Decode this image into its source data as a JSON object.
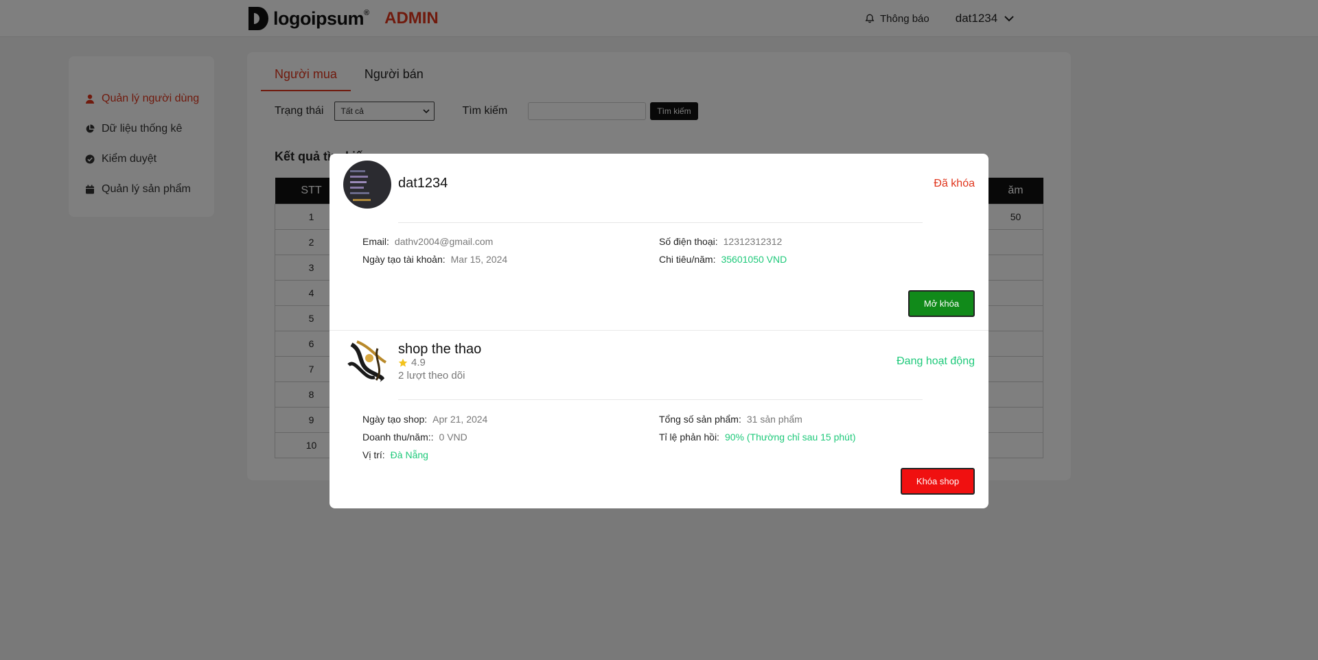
{
  "header": {
    "logo_text": "logoipsum",
    "logo_reg": "®",
    "admin_label": "ADMIN",
    "notification_label": "Thông báo",
    "username": "dat1234"
  },
  "sidebar": {
    "items": [
      {
        "label": "Quản lý người dùng",
        "icon": "user-icon",
        "active": true
      },
      {
        "label": "Dữ liệu thống kê",
        "icon": "pie-chart-icon",
        "active": false
      },
      {
        "label": "Kiểm duyệt",
        "icon": "check-circle-icon",
        "active": false
      },
      {
        "label": "Quản lý sản phẩm",
        "icon": "calendar-icon",
        "active": false
      }
    ]
  },
  "main": {
    "tabs": [
      {
        "label": "Người mua",
        "active": true
      },
      {
        "label": "Người bán",
        "active": false
      }
    ],
    "filters": {
      "status_label": "Trạng thái",
      "status_value": "Tất cả",
      "search_label": "Tìm kiếm",
      "search_value": "",
      "search_button": "Tìm kiếm"
    },
    "result_title": "Kết quả tìm kiếm",
    "table": {
      "headers": [
        "STT",
        "ăm"
      ],
      "rows": [
        {
          "stt": "1",
          "last": "50"
        },
        {
          "stt": "2",
          "last": ""
        },
        {
          "stt": "3",
          "last": ""
        },
        {
          "stt": "4",
          "last": ""
        },
        {
          "stt": "5",
          "last": ""
        },
        {
          "stt": "6",
          "last": ""
        },
        {
          "stt": "7",
          "last": ""
        },
        {
          "stt": "8",
          "last": ""
        },
        {
          "stt": "9",
          "last": ""
        },
        {
          "stt": "10",
          "last": ""
        }
      ]
    }
  },
  "modal": {
    "buyer": {
      "name": "dat1234",
      "status": "Đã khóa",
      "email_label": "Email:",
      "email": "dathv2004@gmail.com",
      "phone_label": "Số điện thoại:",
      "phone": "12312312312",
      "created_label": "Ngày tạo tài khoản:",
      "created": "Mar 15, 2024",
      "spending_label": "Chi tiêu/năm:",
      "spending": "35601050 VND",
      "action_button": "Mở khóa"
    },
    "shop": {
      "name": "shop the thao",
      "rating": "4.9",
      "followers": "2 lượt theo dõi",
      "status": "Đang hoạt động",
      "created_label": "Ngày tạo shop:",
      "created": "Apr 21, 2024",
      "total_products_label": "Tổng số sản phẩm:",
      "total_products": "31 sản phẩm",
      "revenue_label": "Doanh thu/năm::",
      "revenue": "0 VND",
      "response_rate_label": "Tỉ lệ phản hồi:",
      "response_rate": "90% (Thường chỉ sau 15 phút)",
      "location_label": "Vị trí:",
      "location": "Đà Nẵng",
      "action_button": "Khóa shop"
    }
  },
  "colors": {
    "accent_red": "#e0341b",
    "status_green": "#1ec97a",
    "unlock_green": "#118a1a",
    "lock_red": "#f01010"
  }
}
